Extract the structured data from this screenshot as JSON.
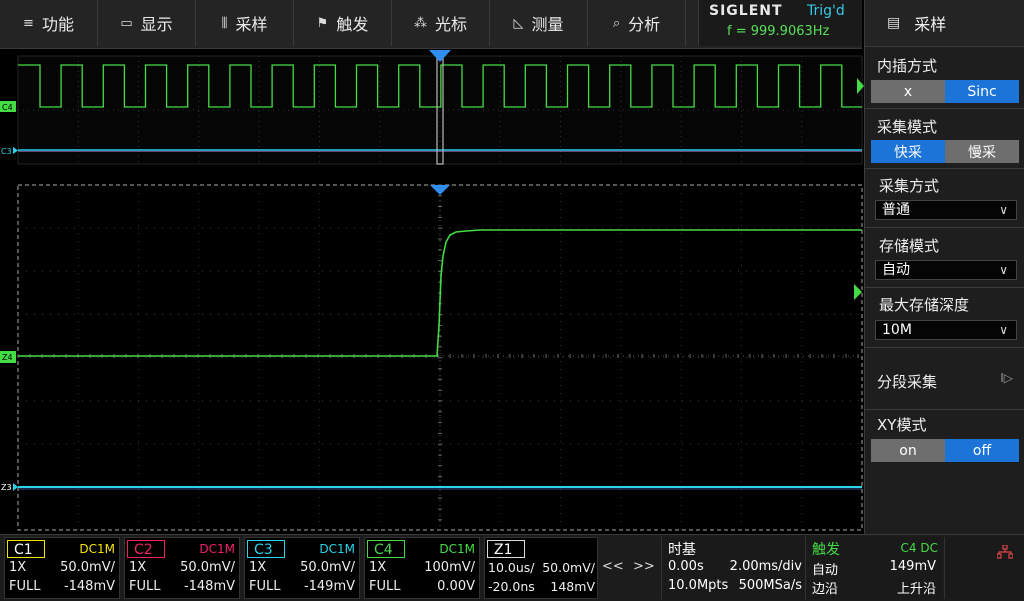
{
  "menu": [
    {
      "icon": "≡",
      "label": "功能",
      "name": "menu-function"
    },
    {
      "icon": "▭",
      "label": "显示",
      "name": "menu-display"
    },
    {
      "icon": "⫼",
      "label": "采样",
      "name": "menu-acquire"
    },
    {
      "icon": "⚑",
      "label": "触发",
      "name": "menu-trigger"
    },
    {
      "icon": "⁂",
      "label": "光标",
      "name": "menu-cursor"
    },
    {
      "icon": "◺",
      "label": "测量",
      "name": "menu-measure"
    },
    {
      "icon": "⌕",
      "label": "分析",
      "name": "menu-analyze"
    }
  ],
  "brand": {
    "logo": "SIGLENT",
    "trig_status": "Trig'd",
    "frequency": "f = 999.9063Hz"
  },
  "panel": {
    "title": "采样",
    "interp": {
      "label": "内插方式",
      "opt_a": "x",
      "opt_b": "Sinc"
    },
    "acq_mode": {
      "label": "采集模式",
      "opt_a": "快采",
      "opt_b": "慢采"
    },
    "acq_type": {
      "label": "采集方式",
      "value": "普通"
    },
    "mem_mode": {
      "label": "存储模式",
      "value": "自动"
    },
    "max_depth": {
      "label": "最大存储深度",
      "value": "10M"
    },
    "segmented": {
      "label": "分段采集",
      "arrow": "I▷"
    },
    "xy": {
      "label": "XY模式",
      "opt_a": "on",
      "opt_b": "off"
    }
  },
  "markers": {
    "c4": "C4",
    "c3": "C3",
    "z4": "Z4",
    "z3": "Z3"
  },
  "channels": [
    {
      "tag": "C1",
      "coupling": "DC1M",
      "probe": "1X",
      "scale": "50.0mV/",
      "bw": "FULL",
      "offset": "-148mV",
      "color": "#f2e200"
    },
    {
      "tag": "C2",
      "coupling": "DC1M",
      "probe": "1X",
      "scale": "50.0mV/",
      "bw": "FULL",
      "offset": "-148mV",
      "color": "#f0206c"
    },
    {
      "tag": "C3",
      "coupling": "DC1M",
      "probe": "1X",
      "scale": "50.0mV/",
      "bw": "FULL",
      "offset": "-149mV",
      "color": "#2ad2ea"
    },
    {
      "tag": "C4",
      "coupling": "DC1M",
      "probe": "1X",
      "scale": "100mV/",
      "bw": "FULL",
      "offset": "0.00V",
      "color": "#44dc44"
    }
  ],
  "zoom": {
    "tag": "Z1",
    "time": "10.0us/",
    "volt": "50.0mV/",
    "delay": "-20.0ns",
    "offset": "148mV"
  },
  "nav": {
    "left": "<<",
    "right": ">>"
  },
  "timebase": {
    "title": "时基",
    "delay": "0.00s",
    "scale": "2.00ms/div",
    "depth": "10.0Mpts",
    "rate": "500MSa/s"
  },
  "trigger": {
    "title": "触发",
    "source": "C4 DC",
    "mode": "自动",
    "level": "149mV",
    "type": "边沿",
    "slope": "上升沿"
  },
  "colors": {
    "c4": "#44dc44",
    "c3": "#2ad2ea",
    "accent": "#1d74d8",
    "trigger_marker": "#2f8ef0"
  }
}
